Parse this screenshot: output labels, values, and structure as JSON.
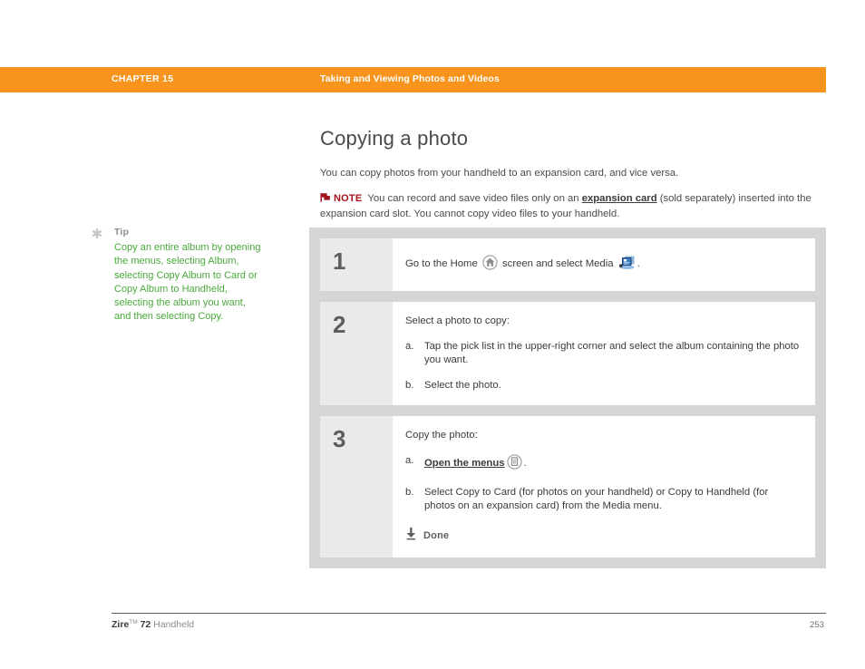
{
  "header": {
    "chapter_label": "CHAPTER 15",
    "chapter_title": "Taking and Viewing Photos and Videos",
    "bar_color": "#f7941e"
  },
  "main": {
    "heading": "Copying a photo",
    "intro": "You can copy photos from your handheld to an expansion card, and vice versa.",
    "note": {
      "label": "NOTE",
      "icon": "note-flag-icon",
      "color": "#a3121a",
      "text_before_link": "You can record and save video files only on an ",
      "link_text": "expansion card",
      "text_after_link": " (sold separately) inserted into the expansion card slot. You cannot copy video files to your handheld."
    }
  },
  "tip": {
    "icon": "asterisk-icon",
    "heading": "Tip",
    "text": "Copy an entire album by opening the menus, selecting Album, selecting Copy Album to Card or Copy Album to Handheld, selecting the album you want, and then selecting Copy.",
    "text_color": "#4aa93c"
  },
  "steps": [
    {
      "number": "1",
      "lead_parts": {
        "a": "Go to the Home ",
        "icon1": "home-icon",
        "b": " screen and select Media ",
        "icon2": "media-icon",
        "c": "."
      }
    },
    {
      "number": "2",
      "lead": "Select a photo to copy:",
      "substeps": [
        {
          "marker": "a.",
          "text": "Tap the pick list in the upper-right corner and select the album containing the photo you want."
        },
        {
          "marker": "b.",
          "text": "Select the photo."
        }
      ]
    },
    {
      "number": "3",
      "lead": "Copy the photo:",
      "substeps": [
        {
          "marker": "a.",
          "link_text": "Open the menus",
          "icon": "menus-icon",
          "trailing": "."
        },
        {
          "marker": "b.",
          "text": "Select Copy to Card (for photos on your handheld) or Copy to Handheld (for photos on an expansion card) from the Media menu."
        }
      ],
      "done": {
        "icon": "down-arrow-icon",
        "label": "Done"
      }
    }
  ],
  "footer": {
    "product_bold": "Zire",
    "trademark": "TM",
    "product_model": " 72",
    "product_rest": " Handheld",
    "page_number": "253"
  }
}
